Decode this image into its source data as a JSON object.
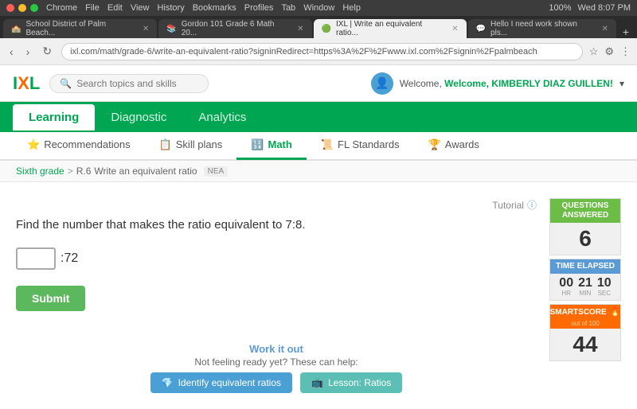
{
  "browser": {
    "menu_items": [
      "Chrome",
      "File",
      "Edit",
      "View",
      "History",
      "Bookmarks",
      "Profiles",
      "Tab",
      "Window",
      "Help"
    ],
    "time": "Wed 8:07 PM",
    "battery": "100%",
    "tabs": [
      {
        "label": "School District of Palm Beach...",
        "active": false,
        "favicon": "🏫"
      },
      {
        "label": "Gordon 101 Grade 6 Math 20...",
        "active": false,
        "favicon": "📚"
      },
      {
        "label": "IXL | Write an equivalent ratio...",
        "active": true,
        "favicon": "🟢"
      },
      {
        "label": "Hello I need work shown pls...",
        "active": false,
        "favicon": "💬"
      }
    ],
    "url": "ixl.com/math/grade-6/write-an-equivalent-ratio?signinRedirect=https%3A%2F%2Fwww.ixl.com%2Fsignin%2Fpalmbeach"
  },
  "header": {
    "logo": "IXL",
    "search_placeholder": "Search topics and skills",
    "welcome_text": "Welcome, KIMBERLY DIAZ GUILLEN!",
    "avatar_char": "👤"
  },
  "nav": {
    "tabs": [
      {
        "label": "Learning",
        "active": false
      },
      {
        "label": "Diagnostic",
        "active": false
      },
      {
        "label": "Analytics",
        "active": false
      }
    ],
    "active_tab": "Learning"
  },
  "sub_nav": {
    "tabs": [
      {
        "label": "Recommendations",
        "icon": "⭐"
      },
      {
        "label": "Skill plans",
        "icon": "📋"
      },
      {
        "label": "Math",
        "icon": "🔢",
        "active": true
      },
      {
        "label": "FL Standards",
        "icon": "📜"
      },
      {
        "label": "Awards",
        "icon": "🏆"
      }
    ]
  },
  "breadcrumb": {
    "grade": "Sixth grade",
    "separator": ">",
    "skill_code": "R.6",
    "skill_name": "Write an equivalent ratio",
    "badge": "NEA"
  },
  "problem": {
    "tutorial_label": "Tutorial",
    "question_text": "Find the number that makes the ratio equivalent to 7:8.",
    "colon_value": ":72",
    "submit_label": "Submit"
  },
  "stats": {
    "questions_answered_label": "Questions answered",
    "questions_answered_value": "6",
    "time_elapsed_label": "Time elapsed",
    "time_hr": "00",
    "time_min": "21",
    "time_sec": "10",
    "time_hr_label": "HR",
    "time_min_label": "MIN",
    "time_sec_label": "SEC",
    "smart_score_label": "SmartScore",
    "smart_score_sub": "out of 100",
    "smart_score_value": "44"
  },
  "help_section": {
    "work_it_out": "Work it out",
    "not_ready_text": "Not feeling ready yet? These can help:",
    "btn1_label": "Identify equivalent ratios",
    "btn2_label": "Lesson: Ratios"
  }
}
